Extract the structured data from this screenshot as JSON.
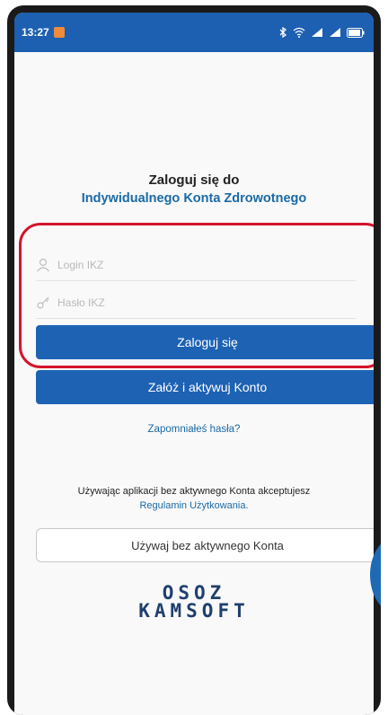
{
  "status_bar": {
    "time": "13:27",
    "right_icons": [
      "bluetooth-icon",
      "wifi-icon",
      "signal-icon",
      "battery-icon"
    ]
  },
  "header": {
    "line1": "Zaloguj się do",
    "line2": "Indywidualnego Konta Zdrowotnego"
  },
  "form": {
    "login_placeholder": "Login IKZ",
    "password_placeholder": "Hasło IKZ",
    "login_button": "Zaloguj się",
    "register_button": "Załóż i aktywuj Konto",
    "forgot_link": "Zapomniałeś hasła?"
  },
  "terms": {
    "text": "Używając aplikacji bez aktywnego Konta akceptujesz",
    "link": "Regulamin Użytkowania."
  },
  "guest_button": "Używaj bez aktywnego Konta",
  "logo": {
    "line1": "OSOZ",
    "line2": "KAMSOFT"
  },
  "colors": {
    "primary": "#1e62b4",
    "link": "#1a6aa6",
    "highlight": "#d4142b",
    "status_bar": "#1d5fb0"
  }
}
